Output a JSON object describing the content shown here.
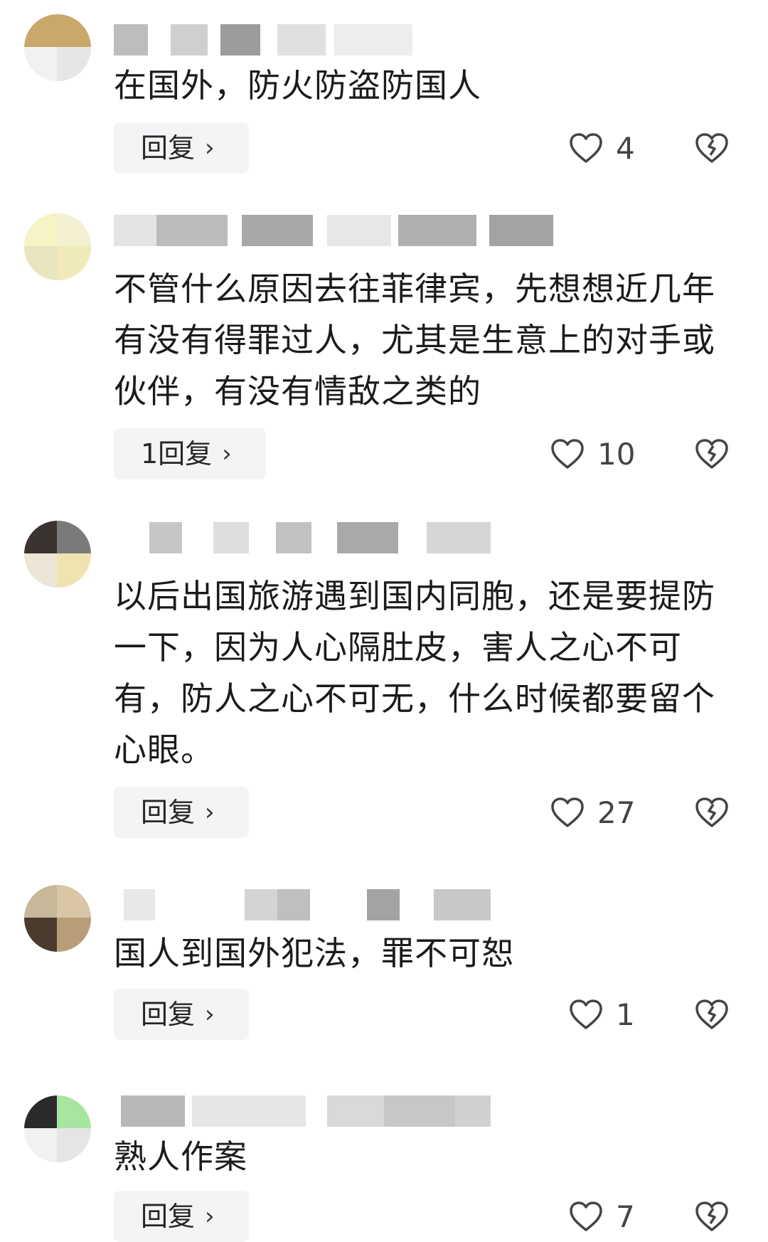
{
  "comments": [
    {
      "text": "在国外，防火防盗防国人",
      "reply_label": "回复",
      "likes": "4"
    },
    {
      "text": "不管什么原因去往菲律宾，先想想近几年有没有得罪过人，尤其是生意上的对手或伙伴，有没有情敌之类的",
      "reply_label": "1回复",
      "likes": "10"
    },
    {
      "text": "以后出国旅游遇到国内同胞，还是要提防一下，因为人心隔肚皮，害人之心不可有，防人之心不可无，什么时候都要留个心眼。",
      "reply_label": "回复",
      "likes": "27"
    },
    {
      "text": "国人到国外犯法，罪不可恕",
      "reply_label": "回复",
      "likes": "1"
    },
    {
      "text": "熟人作案",
      "reply_label": "回复",
      "likes": "7"
    }
  ],
  "icons": {
    "like": "heart-outline-icon",
    "dislike": "broken-heart-icon",
    "chevron": "chevron-right-icon"
  },
  "colors": {
    "reply_bg": "#f3f4f6",
    "text": "#1b1b1b",
    "icon": "#444444"
  }
}
